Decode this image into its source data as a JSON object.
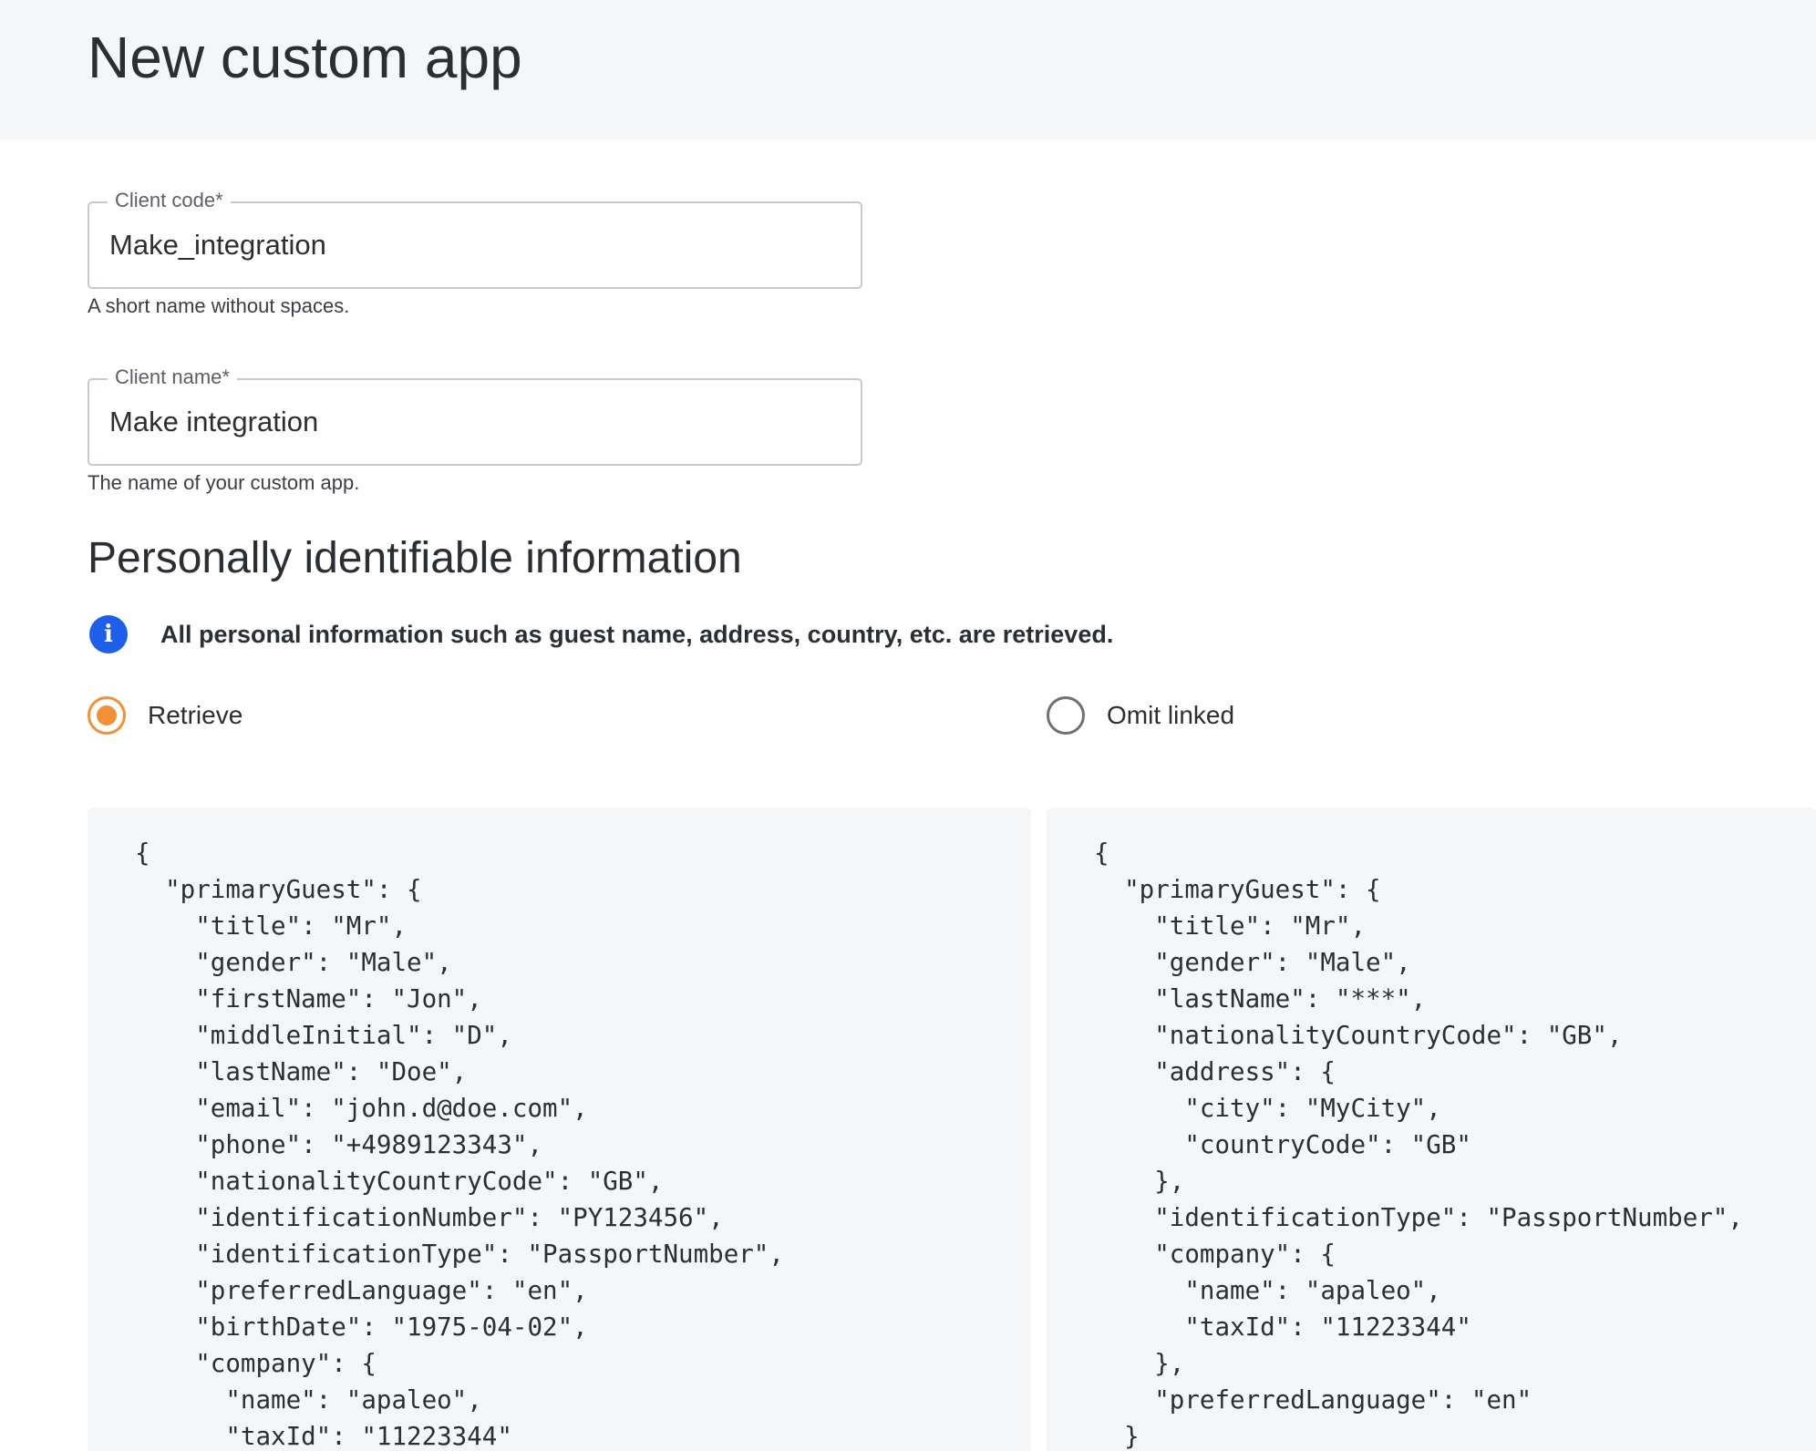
{
  "header": {
    "title": "New custom app"
  },
  "form": {
    "client_code": {
      "label": "Client code*",
      "value": "Make_integration",
      "help": "A short name without spaces."
    },
    "client_name": {
      "label": "Client name*",
      "value": "Make integration",
      "help": "The name of your custom app."
    }
  },
  "pii": {
    "title": "Personally identifiable information",
    "info_icon": "info-icon",
    "info_text": "All personal information such as guest name, address, country, etc. are retrieved.",
    "options": [
      {
        "label": "Retrieve",
        "selected": true
      },
      {
        "label": "Omit linked",
        "selected": false
      }
    ],
    "accent_color": "#f0913a",
    "info_color": "#1f5ee8"
  },
  "code_samples": {
    "retrieve": "{\n  \"primaryGuest\": {\n    \"title\": \"Mr\",\n    \"gender\": \"Male\",\n    \"firstName\": \"Jon\",\n    \"middleInitial\": \"D\",\n    \"lastName\": \"Doe\",\n    \"email\": \"john.d@doe.com\",\n    \"phone\": \"+4989123343\",\n    \"nationalityCountryCode\": \"GB\",\n    \"identificationNumber\": \"PY123456\",\n    \"identificationType\": \"PassportNumber\",\n    \"preferredLanguage\": \"en\",\n    \"birthDate\": \"1975-04-02\",\n    \"company\": {\n      \"name\": \"apaleo\",\n      \"taxId\": \"11223344\"",
    "omit_linked": "{\n  \"primaryGuest\": {\n    \"title\": \"Mr\",\n    \"gender\": \"Male\",\n    \"lastName\": \"***\",\n    \"nationalityCountryCode\": \"GB\",\n    \"address\": {\n      \"city\": \"MyCity\",\n      \"countryCode\": \"GB\"\n    },\n    \"identificationType\": \"PassportNumber\",\n    \"company\": {\n      \"name\": \"apaleo\",\n      \"taxId\": \"11223344\"\n    },\n    \"preferredLanguage\": \"en\"\n  }"
  }
}
